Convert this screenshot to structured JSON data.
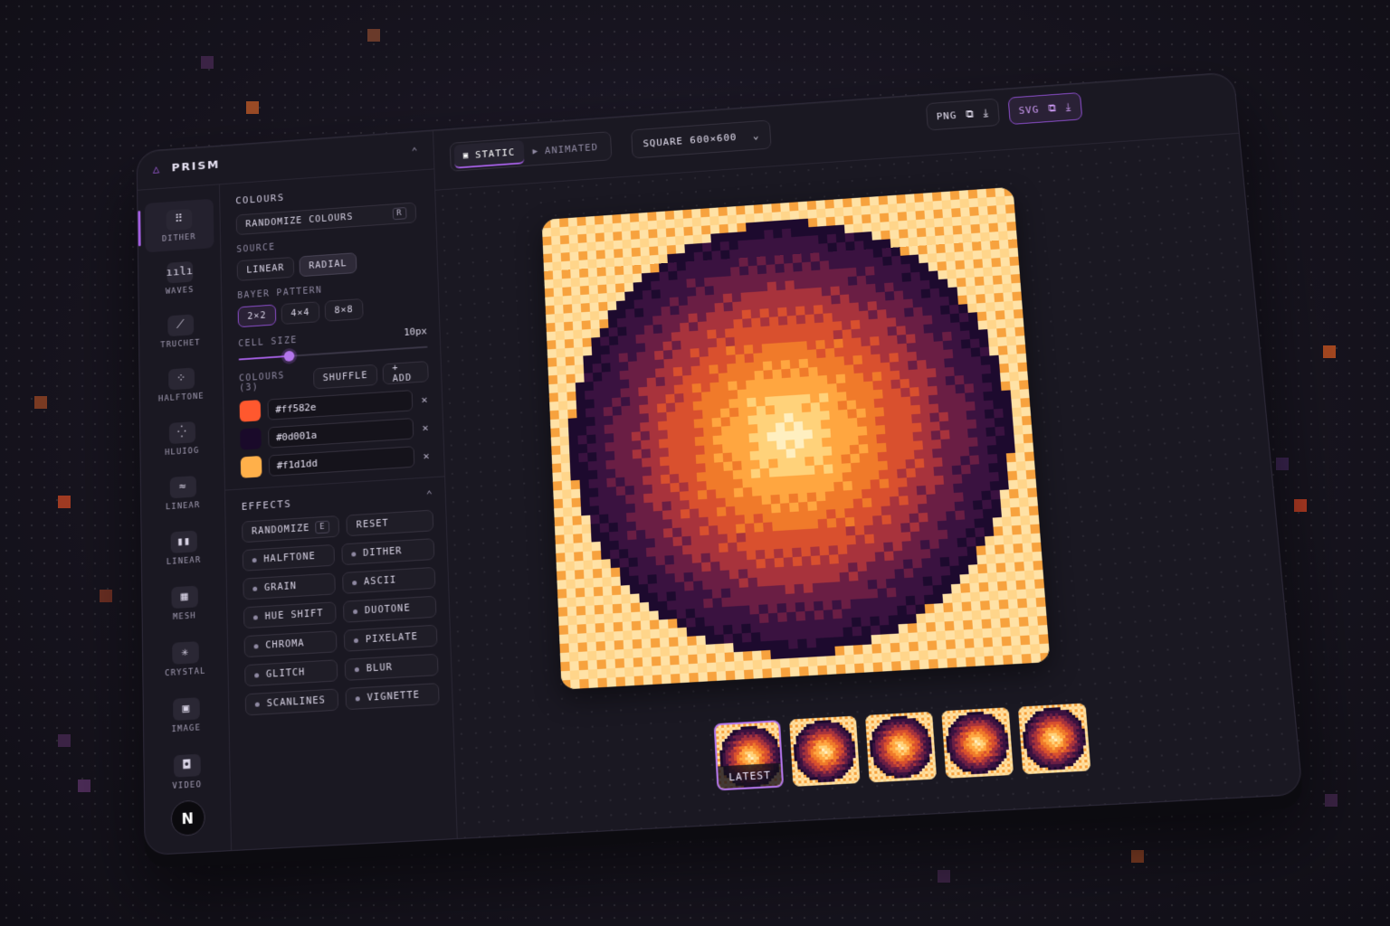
{
  "app": {
    "name": "PRISM"
  },
  "rail": [
    {
      "label": "DITHER",
      "icon": "dither-icon",
      "glyph": "⠿",
      "active": true
    },
    {
      "label": "WAVES",
      "icon": "waves-icon",
      "glyph": "ıılı",
      "active": false
    },
    {
      "label": "TRUCHET",
      "icon": "truchet-icon",
      "glyph": "⟋",
      "active": false
    },
    {
      "label": "HALFTONE",
      "icon": "halftone-icon",
      "glyph": "⁘",
      "active": false
    },
    {
      "label": "HLUIOG",
      "icon": "dots-icon",
      "glyph": "⁛",
      "active": false
    },
    {
      "label": "LINEAR",
      "icon": "linear-wave-icon",
      "glyph": "≈",
      "active": false
    },
    {
      "label": "LINEAR",
      "icon": "linear-bars-icon",
      "glyph": "▮▮",
      "active": false
    },
    {
      "label": "MESH",
      "icon": "mesh-icon",
      "glyph": "▦",
      "active": false
    },
    {
      "label": "CRYSTAL",
      "icon": "crystal-icon",
      "glyph": "✳",
      "active": false
    },
    {
      "label": "IMAGE",
      "icon": "image-icon",
      "glyph": "▣",
      "active": false
    },
    {
      "label": "VIDEO",
      "icon": "video-icon",
      "glyph": "◘",
      "active": false
    }
  ],
  "user": {
    "avatar_letter": "N"
  },
  "panel": {
    "colours_title": "COLOURS",
    "randomize_colours": {
      "label": "RANDOMIZE COLOURS",
      "key": "R"
    },
    "source": {
      "label": "SOURCE",
      "options": [
        "LINEAR",
        "RADIAL"
      ],
      "selected": "RADIAL"
    },
    "bayer": {
      "label": "BAYER PATTERN",
      "options": [
        "2×2",
        "4×4",
        "8×8"
      ],
      "selected": "2×2"
    },
    "cell_size": {
      "label": "CELL SIZE",
      "value_text": "10px",
      "fraction": 0.27
    },
    "colours_list": {
      "label": "COLOURS (3)",
      "shuffle": "SHUFFLE",
      "add": "+ ADD",
      "items": [
        "#ff582e",
        "#0d001a",
        "#f1d1dd"
      ],
      "swatch_colors": [
        "#ff582e",
        "#1a0a2a",
        "#ffb04a"
      ]
    },
    "effects": {
      "title": "EFFECTS",
      "randomize": {
        "label": "RANDOMIZE",
        "key": "E"
      },
      "reset": "RESET",
      "items": [
        "HALFTONE",
        "DITHER",
        "GRAIN",
        "ASCII",
        "HUE SHIFT",
        "DUOTONE",
        "CHROMA",
        "PIXELATE",
        "GLITCH",
        "BLUR",
        "SCANLINES",
        "VIGNETTE"
      ]
    }
  },
  "topbar": {
    "mode": {
      "options": [
        "STATIC",
        "ANIMATED"
      ],
      "selected": "STATIC"
    },
    "size": {
      "label": "SQUARE 600×600"
    },
    "export": [
      {
        "label": "PNG",
        "accent": false
      },
      {
        "label": "SVG",
        "accent": true
      }
    ]
  },
  "history": {
    "latest_label": "LATEST",
    "count": 5
  },
  "colors": {
    "accent": "#a25ee0",
    "palette": [
      "#1d0a2e",
      "#3a1240",
      "#6a1e44",
      "#a8333c",
      "#d9502e",
      "#f07a2a",
      "#ffa640",
      "#ffd27a",
      "#ffefc0"
    ]
  }
}
